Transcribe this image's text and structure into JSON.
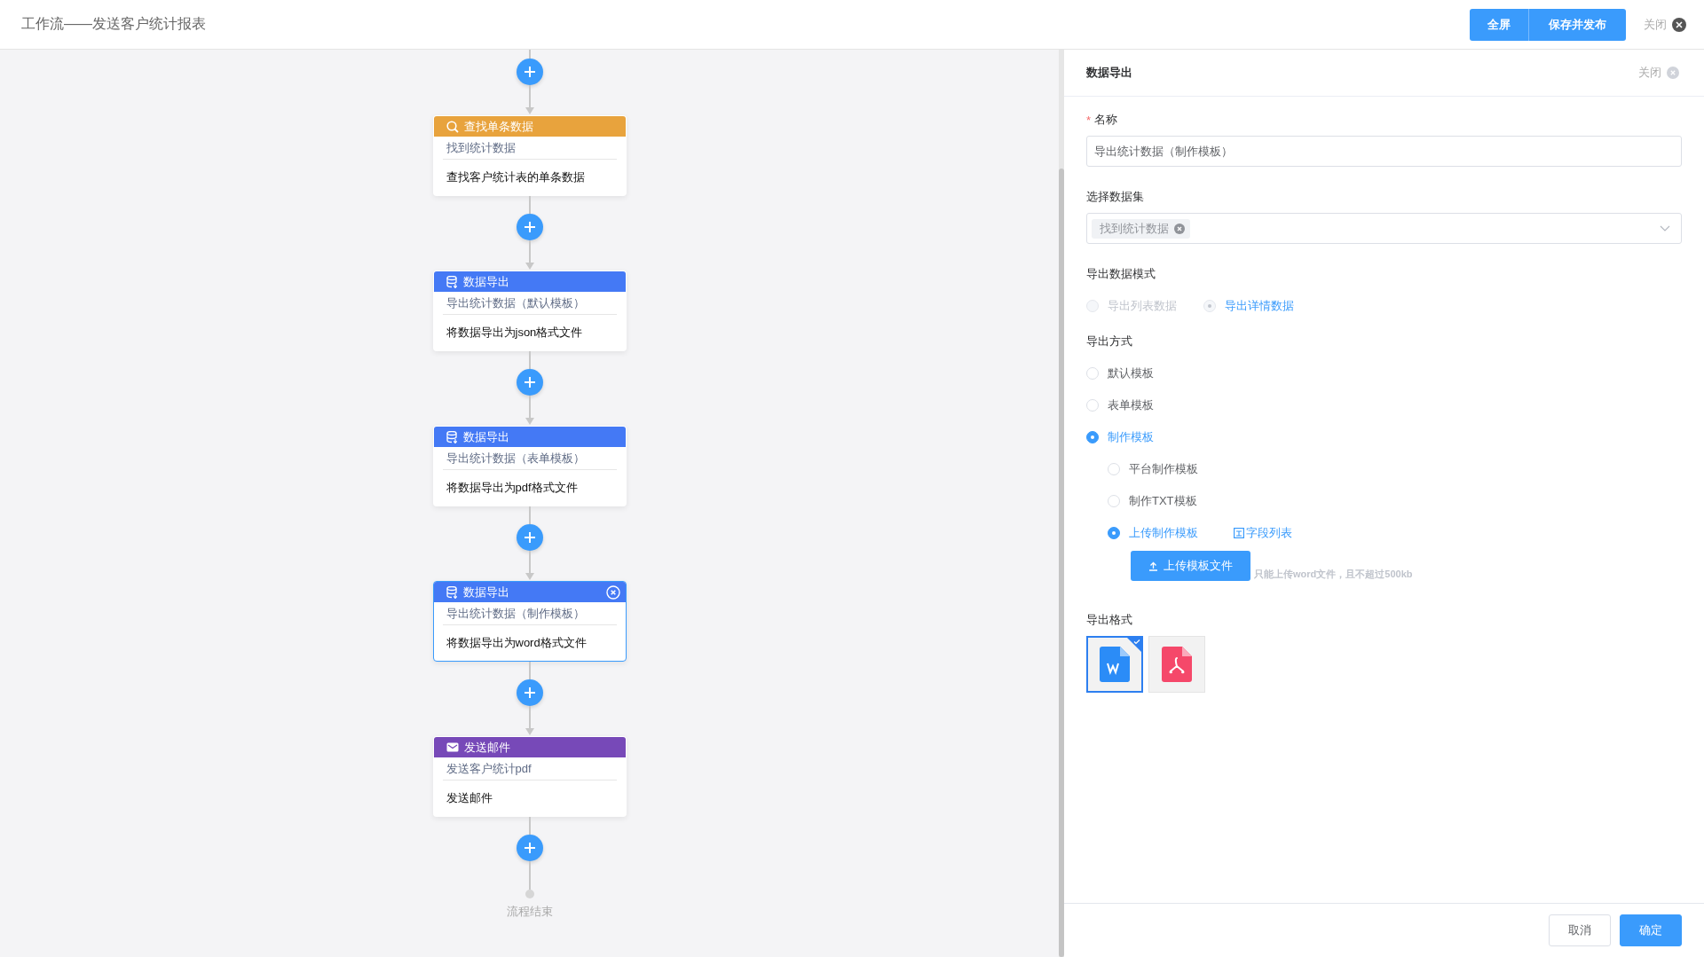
{
  "header": {
    "title": "工作流——发送客户统计报表",
    "buttons": [
      "全屏",
      "保存并发布"
    ],
    "close_label": "关闭"
  },
  "flow": {
    "nodes": [
      {
        "kind": "query",
        "title": "查找单条数据",
        "name": "找到统计数据",
        "description": "查找客户统计表的单条数据",
        "selected": false
      },
      {
        "kind": "export",
        "title": "数据导出",
        "name": "导出统计数据（默认模板）",
        "description": "将数据导出为json格式文件",
        "selected": false
      },
      {
        "kind": "export",
        "title": "数据导出",
        "name": "导出统计数据（表单模板）",
        "description": "将数据导出为pdf格式文件",
        "selected": false
      },
      {
        "kind": "export",
        "title": "数据导出",
        "name": "导出统计数据（制作模板）",
        "description": "将数据导出为word格式文件",
        "selected": true
      },
      {
        "kind": "email",
        "title": "发送邮件",
        "name": "发送客户统计pdf",
        "description": "发送邮件",
        "selected": false
      }
    ],
    "end_label": "流程结束"
  },
  "panel": {
    "title": "数据导出",
    "close_label": "关闭",
    "name_field": {
      "label": "名称",
      "required_mark": "*",
      "value": "导出统计数据（制作模板）"
    },
    "dataset": {
      "label": "选择数据集",
      "tags": [
        "找到统计数据"
      ]
    },
    "mode": {
      "label": "导出数据模式",
      "options": [
        {
          "label": "导出列表数据",
          "selected": false,
          "disabled": true
        },
        {
          "label": "导出详情数据",
          "selected": true,
          "disabled": true
        }
      ]
    },
    "method": {
      "label": "导出方式",
      "options": [
        {
          "label": "默认模板",
          "selected": false
        },
        {
          "label": "表单模板",
          "selected": false
        },
        {
          "label": "制作模板",
          "selected": true,
          "children": [
            {
              "label": "平台制作模板",
              "selected": false
            },
            {
              "label": "制作TXT模板",
              "selected": false
            },
            {
              "label": "上传制作模板",
              "selected": true,
              "link": "字段列表"
            }
          ]
        }
      ]
    },
    "upload": {
      "button": "上传模板文件",
      "hint": "只能上传word文件，且不超过500kb"
    },
    "format": {
      "label": "导出格式",
      "options": [
        {
          "kind": "word",
          "selected": true
        },
        {
          "kind": "pdf",
          "selected": false
        }
      ]
    },
    "buttons": [
      {
        "label": "取消",
        "primary": false
      },
      {
        "label": "确定",
        "primary": true
      }
    ]
  }
}
